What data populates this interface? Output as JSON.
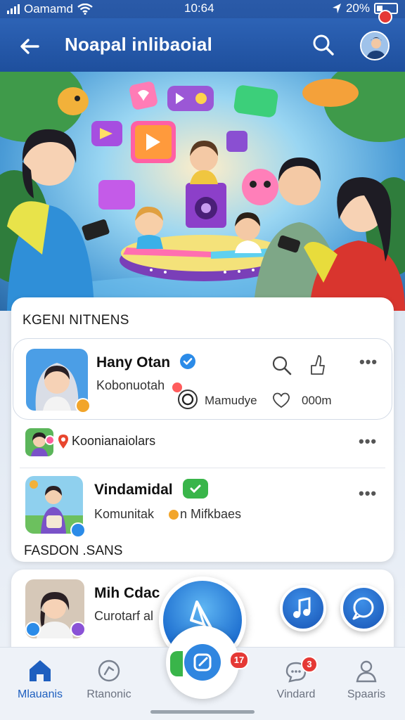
{
  "status_bar": {
    "carrier": "Oamamd",
    "time": "10:64",
    "battery": "20%"
  },
  "app_bar": {
    "title": "Noapal inlibaoial"
  },
  "hero": {
    "alt": "Illustration of a family gathered around a glowing music stage with floating media icons"
  },
  "section1": {
    "title": "KGENI NITNENS",
    "featured": {
      "name": "Hany Otan",
      "subtitle": "Kobonuotah",
      "meta1": "Mamudye",
      "meta2": "000m"
    },
    "items": [
      {
        "name": "Koonianaiolars"
      },
      {
        "name": "Vindamidal",
        "subtitle": "Komunitak",
        "subtitle2": "n Mifkbaes"
      }
    ]
  },
  "section2": {
    "title": "FASDON .SANS",
    "item": {
      "name": "Mih Cdac",
      "subtitle": "Curotarf al"
    }
  },
  "fab": {
    "badge": "17"
  },
  "bottom_nav": {
    "items": [
      {
        "label": "Mlauanis",
        "icon": "home-icon",
        "active": true
      },
      {
        "label": "Rtanonic",
        "icon": "chart-icon",
        "active": false
      },
      {
        "label": "Vindard",
        "icon": "chat-icon",
        "active": false,
        "badge": "3"
      },
      {
        "label": "Spaaris",
        "icon": "user-icon",
        "active": false
      }
    ]
  },
  "colors": {
    "primary": "#1e4f9d",
    "accent": "#2f86e0",
    "badge": "#e53935",
    "verified": "#2b8be8"
  }
}
